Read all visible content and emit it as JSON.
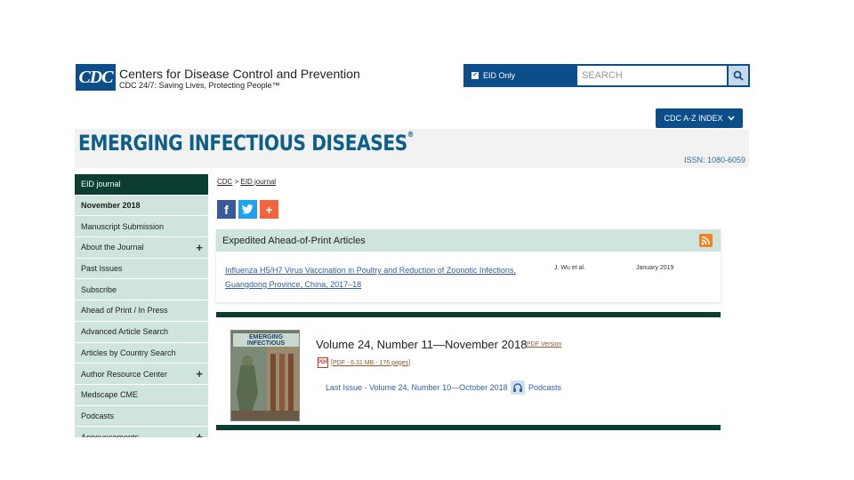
{
  "header": {
    "logo_text": "CDC",
    "org_name": "Centers for Disease Control and Prevention",
    "tagline": "CDC 24/7: Saving Lives, Protecting People™",
    "eid_only_label": "EID Only",
    "search_placeholder": "SEARCH",
    "az_index_label": "CDC A-Z INDEX",
    "icons": {
      "checkbox": "checkbox-checked-icon",
      "search": "search-icon",
      "chevron": "chevron-down-icon"
    }
  },
  "banner": {
    "title": "EMERGING INFECTIOUS DISEASES",
    "registered": "®",
    "issn": "ISSN: 1080-6059"
  },
  "sidebar": {
    "items": [
      {
        "label": "EID journal",
        "style": "dark",
        "expandable": false
      },
      {
        "label": "November 2018",
        "style": "bold",
        "expandable": false
      },
      {
        "label": "Manuscript Submission",
        "style": "normal",
        "expandable": false
      },
      {
        "label": "About the Journal",
        "style": "normal",
        "expandable": true
      },
      {
        "label": "Past Issues",
        "style": "normal",
        "expandable": false
      },
      {
        "label": "Subscribe",
        "style": "normal",
        "expandable": false
      },
      {
        "label": "Ahead of Print / In Press",
        "style": "normal",
        "expandable": false
      },
      {
        "label": "Advanced Article Search",
        "style": "normal",
        "expandable": false
      },
      {
        "label": "Articles by Country Search",
        "style": "normal",
        "expandable": false
      },
      {
        "label": "Author Resource Center",
        "style": "normal",
        "expandable": true
      },
      {
        "label": "Medscape CME",
        "style": "normal",
        "expandable": false
      },
      {
        "label": "Podcasts",
        "style": "normal",
        "expandable": false
      },
      {
        "label": "Announcements",
        "style": "normal",
        "expandable": true
      }
    ],
    "expand_symbol": "+"
  },
  "breadcrumb": {
    "root": "CDC",
    "separator": ">",
    "current": "EID journal"
  },
  "share": {
    "facebook": "f",
    "twitter": "t",
    "addthis": "+"
  },
  "ahead_of_print": {
    "title": "Expedited Ahead-of-Print Articles",
    "article": {
      "title": "Influenza H5/H7 Virus Vaccination in Poultry and Reduction of Zoonotic Infections, Guangdong Province, China, 2017–18",
      "authors": "J. Wu et al.",
      "date": "January 2019"
    }
  },
  "issue": {
    "cover_title": "EMERGING INFECTIOUS DISEASES",
    "title": "Volume 24, Number 11—November 2018",
    "pdf_version": "PDF Version",
    "pdf_size": "[PDF - 6.31 MB - 176 pages]",
    "pdf_icon_label": "PDF",
    "last_issue": "Last Issue - Volume 24, Number 10—October 2018",
    "podcasts": "Podcasts"
  },
  "colors": {
    "cdc_blue": "#0b4e8a",
    "eid_green_dark": "#0b3d31",
    "eid_green_light": "#cfe4dd",
    "link_blue": "#2f5fa1"
  }
}
